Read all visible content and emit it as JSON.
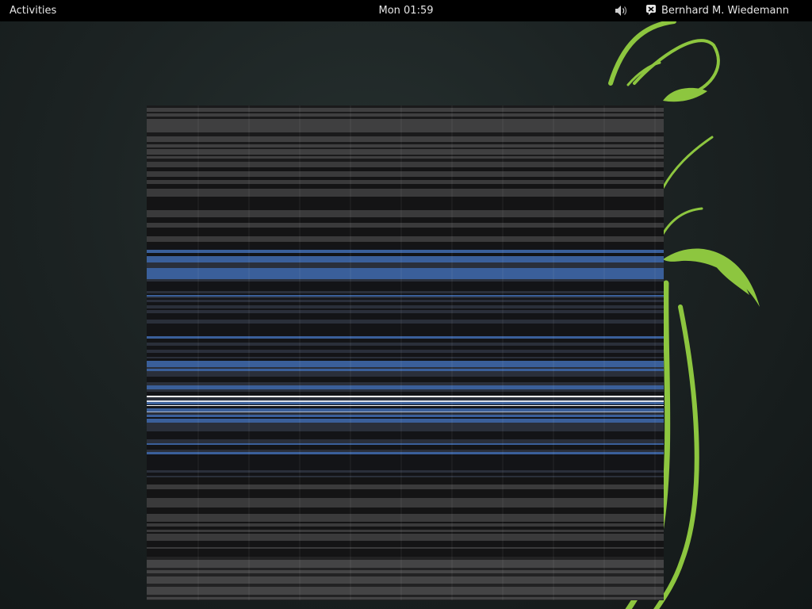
{
  "top_bar": {
    "activities_label": "Activities",
    "clock_text": "Mon 01:59",
    "user_name": "Bernhard M. Wiedemann",
    "volume_icon": "speaker-volume-icon",
    "user_status_icon": "chat-status-icon"
  },
  "colors": {
    "top_bar_bg": "#000000",
    "top_bar_text": "#e6e6e6",
    "wallpaper_bg": "#1c2323",
    "wallpaper_vine": "#8dc63f",
    "window_stripe_dark": "#1e1e1f",
    "window_stripe_gray": "#4a4a4a",
    "window_stripe_blue": "#4c7ac8"
  }
}
